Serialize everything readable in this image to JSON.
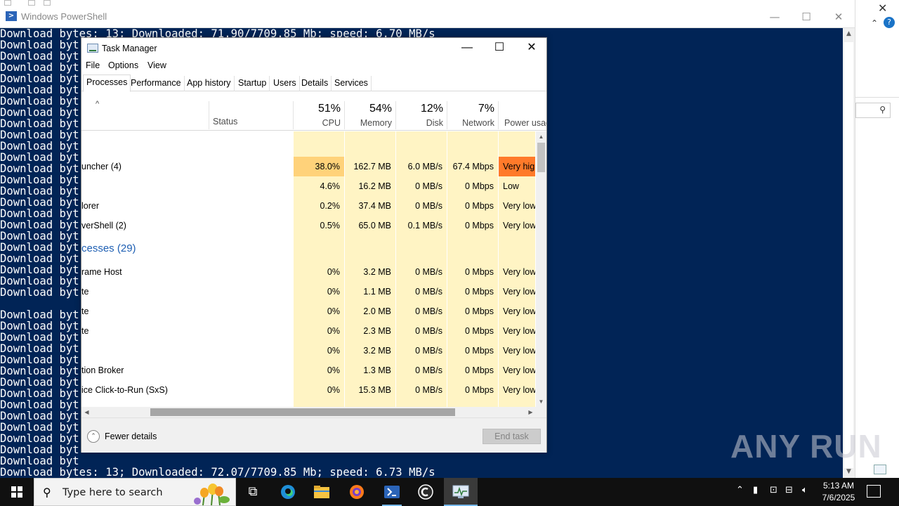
{
  "powershell": {
    "title": "Windows PowerShell",
    "controls": {
      "minimize": "—",
      "maximize": "☐",
      "close": "✕"
    },
    "lines": [
      "Download bytes: 13; Downloaded: 71.90/7709.85 Mb; speed: 6.70 MB/s",
      "Download byt",
      "Download byt",
      "Download byt",
      "Download byt",
      "Download byt",
      "Download byt",
      "Download byt",
      "Download byt",
      "Download byt",
      "Download byt",
      "Download byt",
      "Download byt",
      "Download byt",
      "Download byt",
      "Download byt",
      "Download byt",
      "Download byt",
      "Download byt",
      "Download byt",
      "Download byt",
      "Download byt",
      "Download byt",
      "Download byt",
      "",
      "Download byt",
      "Download byt",
      "Download byt",
      "Download byt",
      "Download byt",
      "Download byt",
      "Download byt",
      "Download byt",
      "Download byt",
      "Download byt",
      "Download byt",
      "Download byt",
      "Download byt",
      "Download byt",
      "Download bytes: 13; Downloaded: 72.07/7709.85 Mb; speed: 6.73 MB/s"
    ]
  },
  "taskmanager": {
    "title": "Task Manager",
    "controls": {
      "minimize": "—",
      "maximize": "☐",
      "close": "✕"
    },
    "menu": [
      "File",
      "Options",
      "View"
    ],
    "tabs": [
      "Processes",
      "Performance",
      "App history",
      "Startup",
      "Users",
      "Details",
      "Services"
    ],
    "active_tab": "Processes",
    "header": {
      "status": "Status",
      "cpu": {
        "pct": "51%",
        "label": "CPU"
      },
      "memory": {
        "pct": "54%",
        "label": "Memory"
      },
      "disk": {
        "pct": "12%",
        "label": "Disk"
      },
      "network": {
        "pct": "7%",
        "label": "Network"
      },
      "power": {
        "label": "Power usag"
      }
    },
    "rows": [
      {
        "name": "",
        "cpu": "",
        "memory": "",
        "disk": "",
        "network": "",
        "power": "",
        "type": "blank"
      },
      {
        "name": "uncher (4)",
        "cpu": "38.0%",
        "memory": "162.7 MB",
        "disk": "6.0 MB/s",
        "network": "67.4 Mbps",
        "power": "Very high",
        "type": "hot"
      },
      {
        "name": "",
        "cpu": "4.6%",
        "memory": "16.2 MB",
        "disk": "0 MB/s",
        "network": "0 Mbps",
        "power": "Low",
        "type": "normal"
      },
      {
        "name": "lorer",
        "cpu": "0.2%",
        "memory": "37.4 MB",
        "disk": "0 MB/s",
        "network": "0 Mbps",
        "power": "Very low",
        "type": "normal"
      },
      {
        "name": "verShell (2)",
        "cpu": "0.5%",
        "memory": "65.0 MB",
        "disk": "0.1 MB/s",
        "network": "0 Mbps",
        "power": "Very low",
        "type": "normal"
      },
      {
        "name": "cesses (29)",
        "cpu": "",
        "memory": "",
        "disk": "",
        "network": "",
        "power": "",
        "type": "group"
      },
      {
        "name": "rame Host",
        "cpu": "0%",
        "memory": "3.2 MB",
        "disk": "0 MB/s",
        "network": "0 Mbps",
        "power": "Very low",
        "type": "normal"
      },
      {
        "name": "te",
        "cpu": "0%",
        "memory": "1.1 MB",
        "disk": "0 MB/s",
        "network": "0 Mbps",
        "power": "Very low",
        "type": "normal"
      },
      {
        "name": "te",
        "cpu": "0%",
        "memory": "2.0 MB",
        "disk": "0 MB/s",
        "network": "0 Mbps",
        "power": "Very low",
        "type": "normal"
      },
      {
        "name": "te",
        "cpu": "0%",
        "memory": "2.3 MB",
        "disk": "0 MB/s",
        "network": "0 Mbps",
        "power": "Very low",
        "type": "normal"
      },
      {
        "name": "",
        "cpu": "0%",
        "memory": "3.2 MB",
        "disk": "0 MB/s",
        "network": "0 Mbps",
        "power": "Very low",
        "type": "normal"
      },
      {
        "name": "tion Broker",
        "cpu": "0%",
        "memory": "1.3 MB",
        "disk": "0 MB/s",
        "network": "0 Mbps",
        "power": "Very low",
        "type": "normal"
      },
      {
        "name": "ice Click-to-Run (SxS)",
        "cpu": "0%",
        "memory": "15.3 MB",
        "disk": "0 MB/s",
        "network": "0 Mbps",
        "power": "Very low",
        "type": "normal"
      },
      {
        "name": "",
        "cpu": "",
        "memory": "",
        "disk": "",
        "network": "",
        "power": "",
        "type": "blank"
      }
    ],
    "footer": {
      "fewer_details": "Fewer details",
      "end_task": "End task"
    }
  },
  "watermark": "ANY RUN",
  "taskbar": {
    "search_placeholder": "Type here to search",
    "time": "5:13 AM",
    "date": "7/6/2025"
  },
  "colors": {
    "ps_background": "#012456",
    "cpu_hot": "#ffd27a",
    "power_very_high": "#ff7a2a",
    "cell_default": "#fff4c4",
    "group_text": "#1e5fb3"
  }
}
